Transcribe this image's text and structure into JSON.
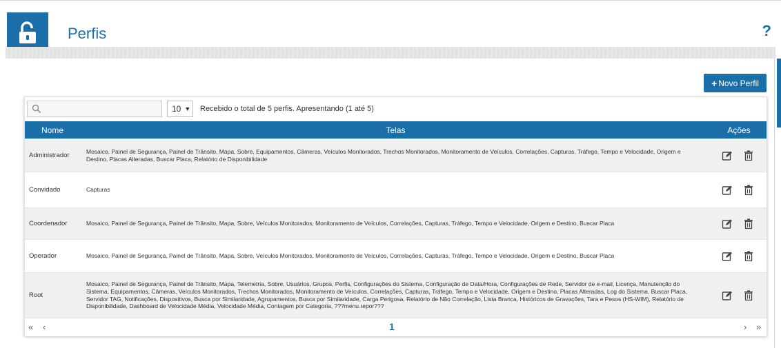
{
  "header": {
    "title": "Perfis",
    "help_label": "?"
  },
  "toolbar": {
    "new_button_label": "Novo Perfil",
    "search_placeholder": "",
    "page_size": "10",
    "info_text": "Recebido o total de 5 perfis. Apresentando (1 até 5)"
  },
  "table": {
    "columns": [
      "Nome",
      "Telas",
      "Ações"
    ],
    "rows": [
      {
        "nome": "Administrador",
        "telas": "Mosaico, Painel de Segurança, Painel de Trânsito, Mapa, Sobre, Equipamentos, Câmeras, Veículos Monitorados, Trechos Monitorados, Monitoramento de Veículos, Correlações, Capturas, Tráfego, Tempo e Velocidade, Origem e Destino, Placas Alteradas, Buscar Placa, Relatório de Disponibilidade"
      },
      {
        "nome": "Convidado",
        "telas": "Capturas"
      },
      {
        "nome": "Coordenador",
        "telas": "Mosaico, Painel de Segurança, Painel de Trânsito, Mapa, Sobre, Veículos Monitorados, Monitoramento de Veículos, Correlações, Capturas, Tráfego, Tempo e Velocidade, Origem e Destino, Buscar Placa"
      },
      {
        "nome": "Operador",
        "telas": "Mosaico, Painel de Segurança, Painel de Trânsito, Mapa, Sobre, Veículos Monitorados, Monitoramento de Veículos, Correlações, Capturas, Tráfego, Tempo e Velocidade, Origem e Destino, Buscar Placa"
      },
      {
        "nome": "Root",
        "telas": "Mosaico, Painel de Segurança, Painel de Trânsito, Mapa, Telemetria, Sobre, Usuários, Grupos, Perfis, Configurações do Sistema, Configuração de Data/Hora, Configurações de Rede, Servidor de e-mail, Licença, Manutenção do Sistema, Equipamentos, Câmeras, Veículos Monitorados, Trechos Monitorados, Monitoramento de Veículos, Correlações, Capturas, Tráfego, Tempo e Velocidade, Origem e Destino, Placas Alteradas, Log do Sistema, Buscar Placa, Servidor TAG, Notificações, Dispositivos, Busca por Similaridade, Agrupamentos, Busca por Similaridade, Carga Perigosa, Relatório de Não Correlação, Lista Branca, Históricos de Gravações, Tara e Pesos (HS-WIM), Relatório de Disponibilidade, Dashboard de Velocidade Média, Velocidade Média, Contagem por Categoria, ???menu.repor???"
      }
    ]
  },
  "pagination": {
    "first": "«",
    "prev": "‹",
    "current": "1",
    "next": "›",
    "last": "»"
  },
  "colors": {
    "accent": "#1b6fa8",
    "row_alt": "#f0f0f0"
  },
  "icons": {
    "logo": "unlocked-padlock-icon",
    "search": "search-icon",
    "edit": "edit-icon",
    "delete": "trash-icon"
  }
}
